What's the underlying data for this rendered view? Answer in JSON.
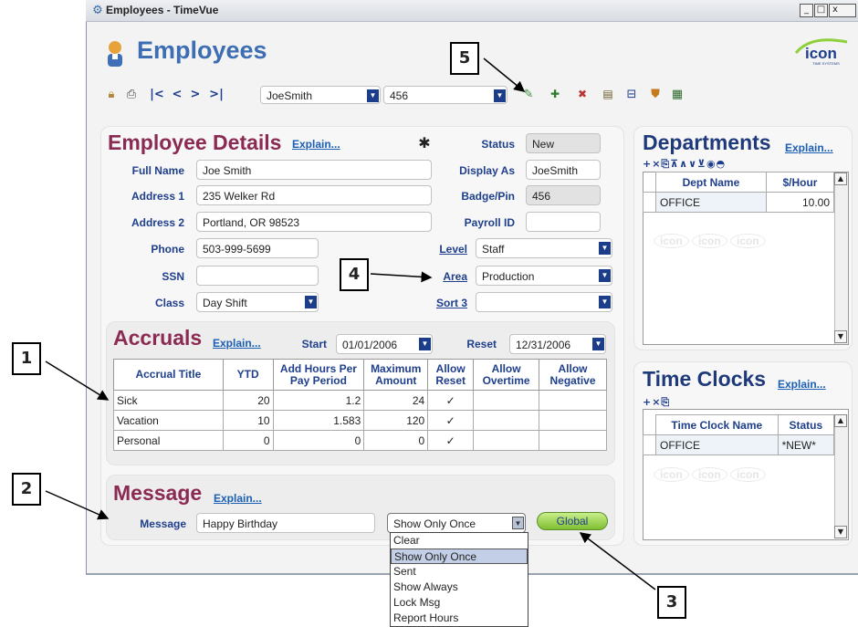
{
  "window": {
    "title": "Employees - TimeVue",
    "min": "_",
    "max": "□",
    "close": "x"
  },
  "app": {
    "title": "Employees",
    "logo": "icon",
    "logo_sub": "TIME SYSTEMS"
  },
  "toolbar": {
    "first": "|<",
    "prev": "<",
    "next": ">",
    "last": ">|",
    "employee_select": "JoeSmith",
    "badge_select": "456"
  },
  "details": {
    "heading": "Employee Details",
    "explain": "Explain...",
    "full_name_label": "Full Name",
    "full_name": "Joe Smith",
    "address1_label": "Address 1",
    "address1": "235 Welker Rd",
    "address2_label": "Address 2",
    "address2": "Portland, OR 98523",
    "phone_label": "Phone",
    "phone": "503-999-5699",
    "ssn_label": "SSN",
    "ssn": "",
    "class_label": "Class",
    "class": "Day Shift",
    "status_label": "Status",
    "status": "New",
    "display_as_label": "Display As",
    "display_as": "JoeSmith",
    "badge_label": "Badge/Pin",
    "badge": "456",
    "payroll_label": "Payroll ID",
    "payroll": "",
    "level_label": "Level",
    "level": "Staff",
    "area_label": "Area",
    "area": "Production",
    "sort3_label": "Sort 3",
    "sort3": ""
  },
  "accruals": {
    "heading": "Accruals",
    "explain": "Explain...",
    "start_label": "Start",
    "start": "01/01/2006",
    "reset_label": "Reset",
    "reset": "12/31/2006",
    "columns": [
      "Accrual Title",
      "YTD",
      "Add Hours Per Pay Period",
      "Maximum Amount",
      "Allow Reset",
      "Allow Overtime",
      "Allow Negative"
    ],
    "rows": [
      [
        "Sick",
        "20",
        "1.2",
        "24",
        "✓",
        "",
        ""
      ],
      [
        "Vacation",
        "10",
        "1.583",
        "120",
        "✓",
        "",
        ""
      ],
      [
        "Personal",
        "0",
        "0",
        "0",
        "✓",
        "",
        ""
      ]
    ]
  },
  "message": {
    "heading": "Message",
    "explain": "Explain...",
    "label": "Message",
    "value": "Happy Birthday",
    "mode": "Show Only Once",
    "global_button": "Global",
    "options": [
      "Clear",
      "Show Only Once",
      "Sent",
      "Show Always",
      "Lock Msg",
      "Report Hours"
    ]
  },
  "departments": {
    "heading": "Departments",
    "explain": "Explain...",
    "tools": "+×⎘⊼∧∨⊻◉◓",
    "columns": [
      "Dept Name",
      "$/Hour"
    ],
    "rows": [
      [
        "OFFICE",
        "10.00"
      ]
    ]
  },
  "timeclocks": {
    "heading": "Time Clocks",
    "explain": "Explain...",
    "tools": "+×⎘",
    "columns": [
      "Time Clock Name",
      "Status"
    ],
    "rows": [
      [
        "OFFICE",
        "*NEW*"
      ]
    ]
  },
  "callouts": [
    "1",
    "2",
    "3",
    "4",
    "5"
  ],
  "colors": {
    "title_blue": "#3d6db3",
    "section_maroon": "#8b2a52",
    "label_blue": "#1f3f8c",
    "link_blue": "#1a5fb4",
    "global_green": "#8fcf3c"
  }
}
